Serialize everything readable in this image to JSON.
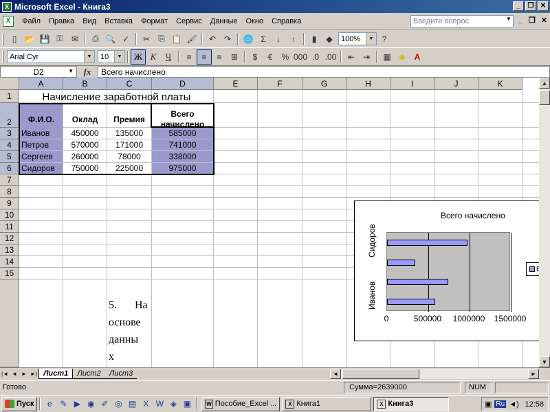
{
  "window": {
    "title": "Microsoft Excel - Книга3",
    "app_icon": "X",
    "controls": [
      "_",
      "❐",
      "✕"
    ]
  },
  "menubar": {
    "items": [
      "Файл",
      "Правка",
      "Вид",
      "Вставка",
      "Формат",
      "Сервис",
      "Данные",
      "Окно",
      "Справка"
    ],
    "help_placeholder": "Введите вопрос",
    "doc_controls": [
      "_",
      "❐",
      "✕"
    ]
  },
  "toolbar": {
    "zoom": "100%",
    "font_name": "Arial Cyr",
    "font_size": "10",
    "bold": "Ж",
    "italic": "К",
    "underline": "Ч"
  },
  "formula_bar": {
    "name_box": "D2",
    "fx": "fx",
    "content": "Всего начислено"
  },
  "columns": [
    "A",
    "B",
    "C",
    "D",
    "E",
    "F",
    "G",
    "H",
    "I",
    "J",
    "K"
  ],
  "rows": [
    "1",
    "2",
    "3",
    "4",
    "5",
    "6",
    "7",
    "8",
    "9",
    "10",
    "11",
    "12",
    "13",
    "14",
    "15"
  ],
  "sheet": {
    "title": "Начисление заработной платы",
    "headers": [
      "Ф.И.О.",
      "Оклад",
      "Премия",
      "Всего начислено"
    ],
    "header_d_line1": "Всего",
    "header_d_line2": "начислено",
    "data": [
      {
        "name": "Иванов",
        "salary": "450000",
        "bonus": "135000",
        "total": "585000"
      },
      {
        "name": "Петров",
        "salary": "570000",
        "bonus": "171000",
        "total": "741000"
      },
      {
        "name": "Сергеев",
        "salary": "260000",
        "bonus": "78000",
        "total": "338000"
      },
      {
        "name": "Сидоров",
        "salary": "750000",
        "bonus": "225000",
        "total": "975000"
      }
    ],
    "overlay_text": [
      "5.",
      "На",
      "основе",
      "данны",
      "х"
    ]
  },
  "chart_data": {
    "type": "bar",
    "orientation": "horizontal",
    "title": "Всего начислено",
    "categories": [
      "Иванов",
      "Петров",
      "Сергеев",
      "Сидоров"
    ],
    "category_labels_shown": [
      "Иванов",
      "Сидоров"
    ],
    "series": [
      {
        "values": [
          585000,
          741000,
          338000,
          975000
        ],
        "color": "#9999ff"
      }
    ],
    "x_ticks": [
      "0",
      "500000",
      "1000000",
      "1500000"
    ],
    "xlim": [
      0,
      1500000
    ],
    "grid": true,
    "plot_background": "#c0c0c0",
    "legend_placement": "right",
    "legend_text": "В"
  },
  "tabs": {
    "sheets": [
      "Лист1",
      "Лист2",
      "Лист3"
    ],
    "active": "Лист1"
  },
  "status": {
    "ready": "Готово",
    "sum": "Сумма=2639000",
    "num": "NUM"
  },
  "taskbar": {
    "start": "Пуск",
    "items": [
      "Пособие_Excel ...",
      "Книга1",
      "Книга3"
    ],
    "active": "Книга3",
    "lang": "Ru",
    "clock": "12:58"
  },
  "colors": {
    "title_bar": "#0a246a",
    "highlight_fill": "#9999cc",
    "series_fill": "#9999ff"
  }
}
